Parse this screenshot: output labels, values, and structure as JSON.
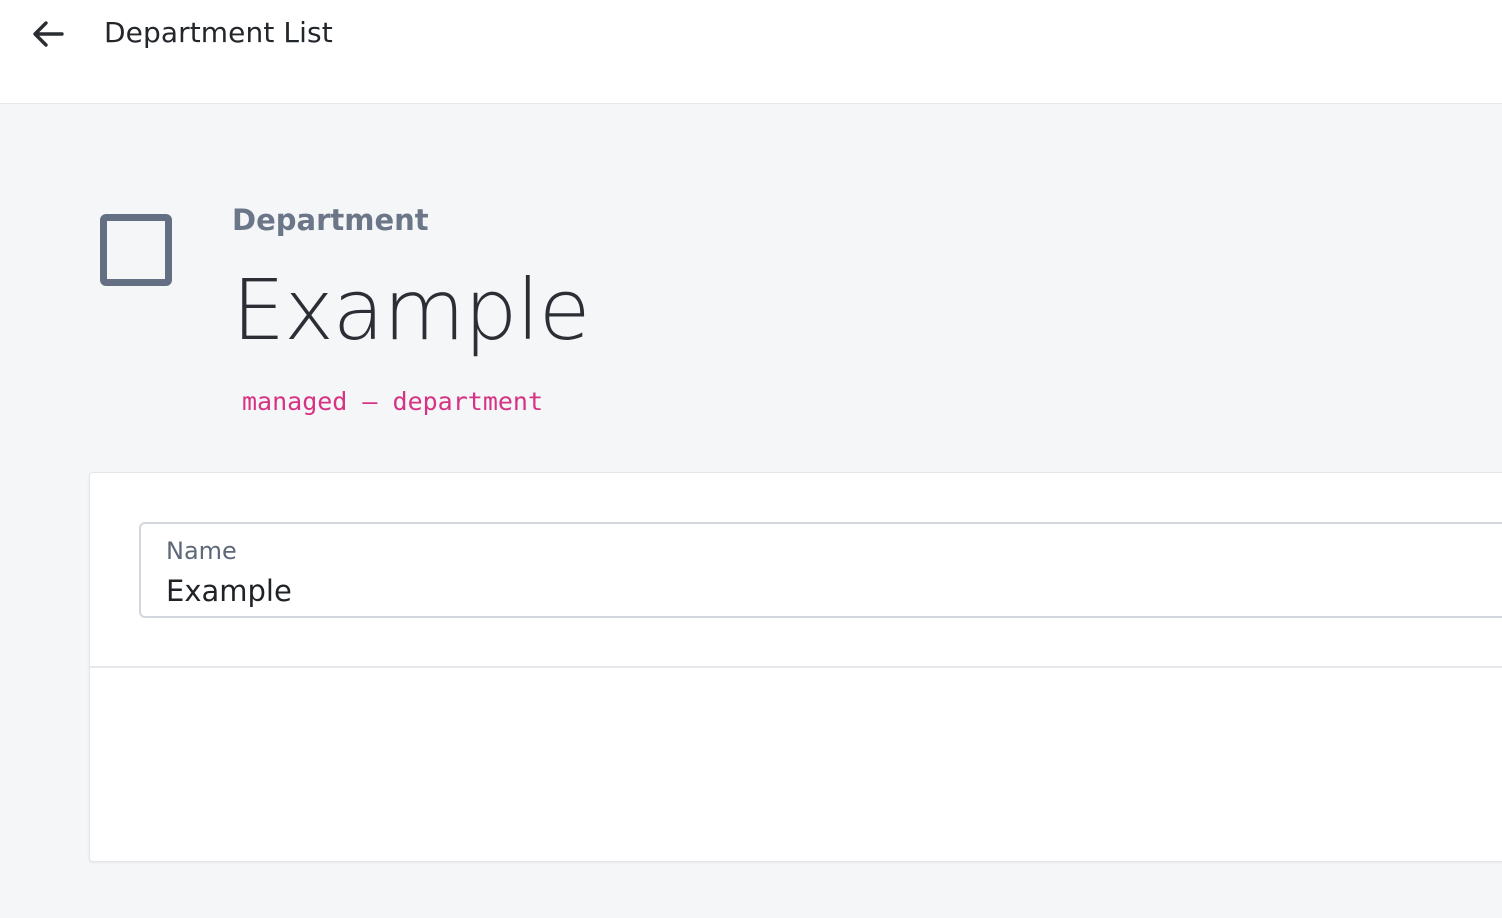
{
  "header": {
    "back_icon": "arrow-left-icon",
    "title": "Department List"
  },
  "entity": {
    "icon": "square-outline-icon",
    "kind": "Department",
    "title": "Example",
    "slug": "managed – department"
  },
  "form": {
    "fields": [
      {
        "label": "Name",
        "value": "Example"
      }
    ]
  },
  "colors": {
    "slug": "#d63384",
    "icon": "#646f83",
    "background": "#f5f6f8"
  }
}
